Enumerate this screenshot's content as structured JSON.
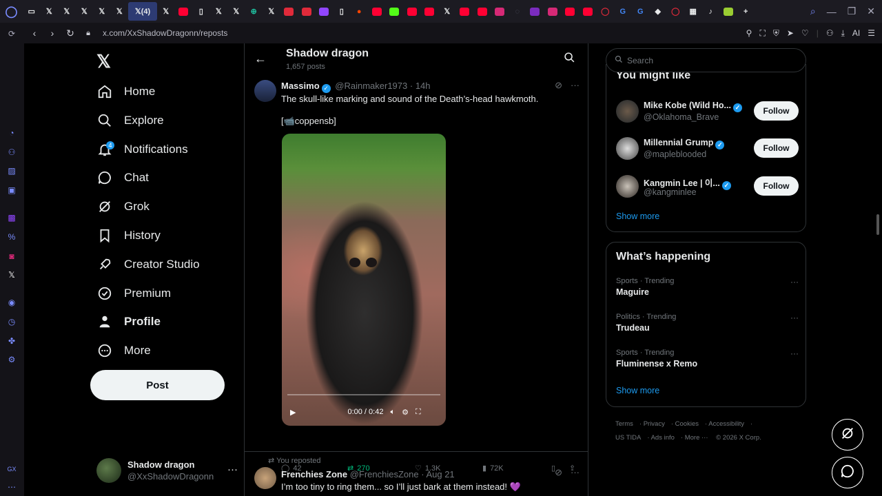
{
  "browser": {
    "active_tab_label": "(4)",
    "url": "x.com/XxShadowDragonn/reposts",
    "ai_label": "AI"
  },
  "nav": {
    "home": "Home",
    "explore": "Explore",
    "notifications": "Notifications",
    "notifications_badge": "4",
    "chat": "Chat",
    "grok": "Grok",
    "history": "History",
    "creator_studio": "Creator Studio",
    "premium": "Premium",
    "profile": "Profile",
    "more": "More",
    "post_button": "Post"
  },
  "account": {
    "name": "Shadow dragon",
    "handle": "@XxShadowDragonn"
  },
  "header": {
    "title": "Shadow dragon",
    "subtitle": "1,657 posts"
  },
  "post1": {
    "author": "Massimo",
    "handle": "@Rainmaker1973",
    "time": "· 14h",
    "text": "The skull-like marking and sound of the Death’s-head hawkmoth.",
    "credit": "[📹coppensb]",
    "video_time": "0:00 / 0:42",
    "replies": "42",
    "reposts": "270",
    "likes": "1.3K",
    "views": "72K"
  },
  "post2": {
    "repost_label": "You reposted",
    "author": "Frenchies Zone",
    "handle": "@FrenchiesZone",
    "time": "· Aug 21",
    "text": "I’m too tiny to ring them... so I’ll just bark at them instead! 💜"
  },
  "right": {
    "search_placeholder": "Search",
    "you_might_like": "You might like",
    "who": [
      {
        "name": "Mike Kobe (Wild Ho...",
        "handle": "@Oklahoma_Brave",
        "follow": "Follow"
      },
      {
        "name": "Millennial Grump",
        "handle": "@mapleblooded",
        "follow": "Follow"
      },
      {
        "name": "Kangmin Lee | 이...",
        "handle": "@kangminlee",
        "follow": "Follow"
      }
    ],
    "show_more": "Show more",
    "whats_happening": "What’s happening",
    "trends": [
      {
        "category": "Sports · Trending",
        "name": "Maguire"
      },
      {
        "category": "Politics · Trending",
        "name": "Trudeau"
      },
      {
        "category": "Sports · Trending",
        "name": "Fluminense x Remo"
      }
    ],
    "show_more_2": "Show more",
    "footer": [
      "Terms",
      "Privacy",
      "Cookies",
      "Accessibility",
      "US TIDA",
      "Ads info",
      "More ···",
      "© 2026 X Corp."
    ]
  },
  "colors": {
    "accent": "#1d9bf0",
    "repost_green": "#00ba7c",
    "muted": "#71767b"
  }
}
